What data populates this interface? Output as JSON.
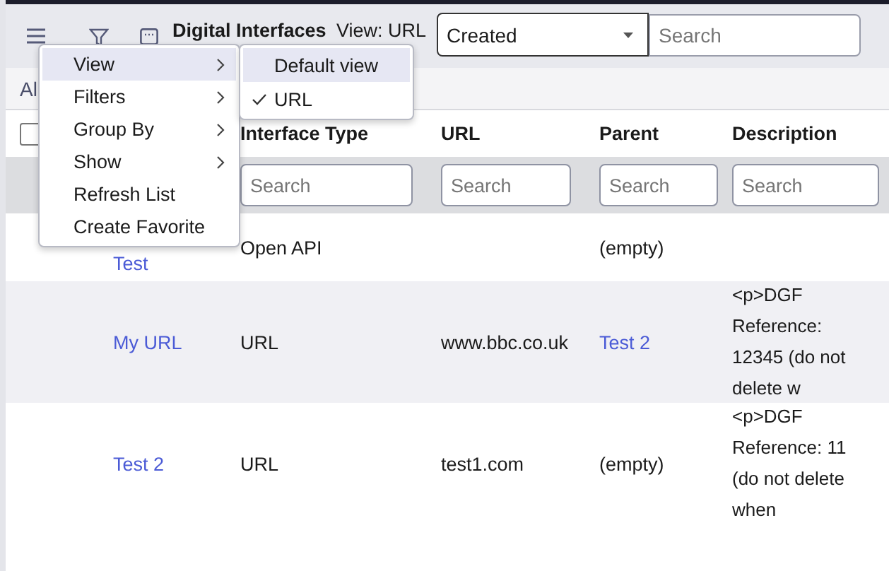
{
  "header": {
    "title": "Digital Interfaces",
    "view_label": "View: URL",
    "field_select": "Created",
    "search_placeholder": "Search"
  },
  "breadcrumb": "Al",
  "select_all_checked": false,
  "columns": [
    {
      "label": "Interface Type",
      "search_placeholder": "Search"
    },
    {
      "label": "URL",
      "search_placeholder": "Search"
    },
    {
      "label": "Parent",
      "search_placeholder": "Search"
    },
    {
      "label": "Description",
      "search_placeholder": "Search"
    }
  ],
  "rows": [
    {
      "name": "Test",
      "type": "Open API",
      "url": "",
      "parent": "(empty)",
      "parent_is_link": false,
      "description": "",
      "highlighted": false
    },
    {
      "name": "My URL",
      "type": "URL",
      "url": "www.bbc.co.uk",
      "parent": "Test 2",
      "parent_is_link": true,
      "description": "<p>DGF Reference: 12345 (do not delete w",
      "highlighted": true
    },
    {
      "name": "Test 2",
      "type": "URL",
      "url": "test1.com",
      "parent": "(empty)",
      "parent_is_link": false,
      "description": "<p>DGF Reference: 11 (do not delete when",
      "highlighted": false
    }
  ],
  "context_menu": [
    {
      "label": "View",
      "has_submenu": true,
      "selected": true
    },
    {
      "label": "Filters",
      "has_submenu": true,
      "selected": false
    },
    {
      "label": "Group By",
      "has_submenu": true,
      "selected": false
    },
    {
      "label": "Show",
      "has_submenu": true,
      "selected": false
    },
    {
      "label": "Refresh List",
      "has_submenu": false,
      "selected": false
    },
    {
      "label": "Create Favorite",
      "has_submenu": false,
      "selected": false
    }
  ],
  "view_submenu": [
    {
      "label": "Default view",
      "checked": false,
      "selected": true
    },
    {
      "label": "URL",
      "checked": true,
      "selected": false
    }
  ]
}
